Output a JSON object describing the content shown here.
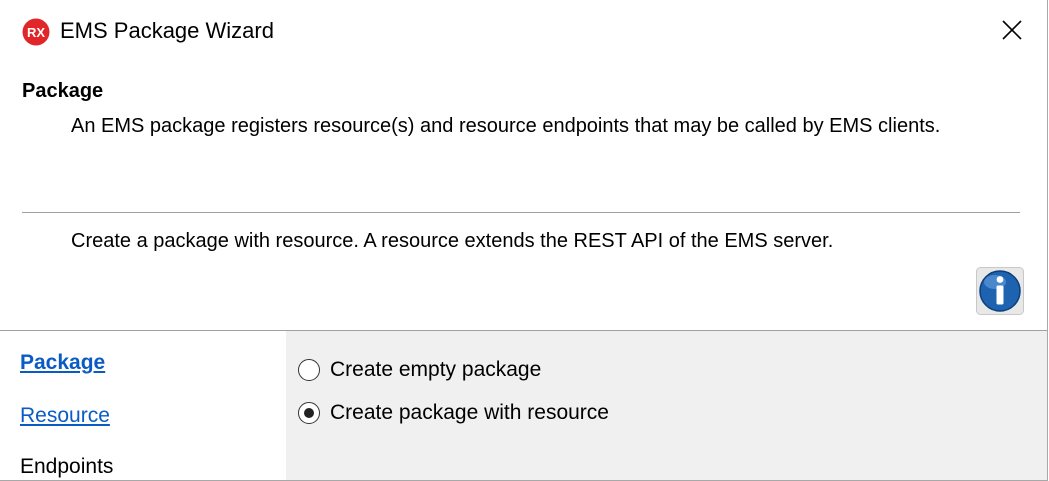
{
  "window": {
    "title": "EMS Package Wizard",
    "app_icon_text": "RX"
  },
  "header": {
    "title": "Package",
    "description": "An EMS package registers resource(s) and resource endpoints that may be called by EMS clients.",
    "info_text": "Create a package with resource.  A resource extends the REST API of the EMS server."
  },
  "nav": {
    "items": [
      {
        "label": "Package",
        "state": "current-link"
      },
      {
        "label": "Resource",
        "state": "link"
      },
      {
        "label": "Endpoints",
        "state": "plain"
      }
    ]
  },
  "options": [
    {
      "label": "Create empty package",
      "checked": false
    },
    {
      "label": "Create package with resource",
      "checked": true
    }
  ],
  "colors": {
    "link": "#0a5bc4",
    "content_bg": "#f0f0f0",
    "app_icon": "#e1262a",
    "info_icon": "#1e63b0"
  }
}
